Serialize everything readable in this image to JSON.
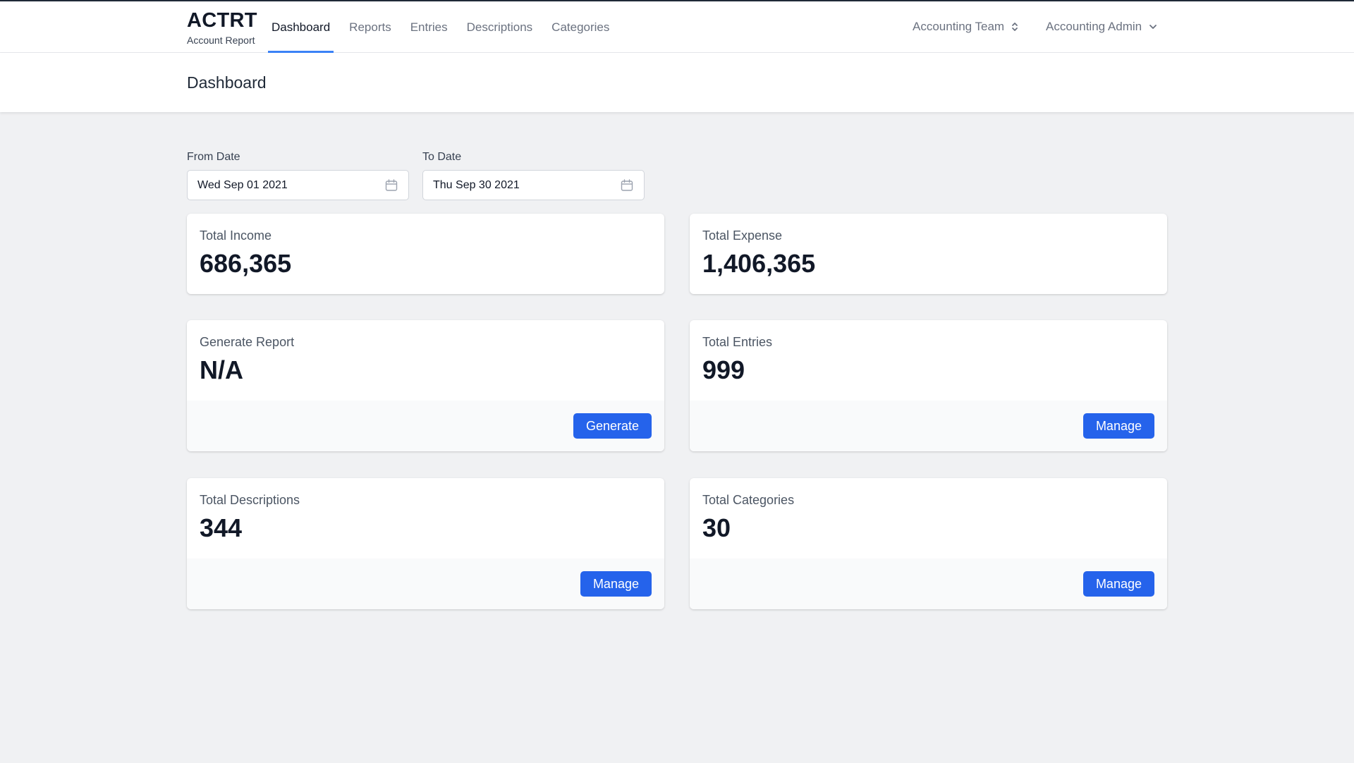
{
  "app": {
    "brand_title": "ACTRT",
    "brand_subtitle": "Account Report"
  },
  "nav": {
    "tabs": [
      {
        "label": "Dashboard",
        "active": true
      },
      {
        "label": "Reports",
        "active": false
      },
      {
        "label": "Entries",
        "active": false
      },
      {
        "label": "Descriptions",
        "active": false
      },
      {
        "label": "Categories",
        "active": false
      }
    ],
    "team": "Accounting Team",
    "user": "Accounting Admin"
  },
  "header": {
    "title": "Dashboard"
  },
  "filters": {
    "from_label": "From Date",
    "from_value": "Wed Sep 01 2021",
    "to_label": "To Date",
    "to_value": "Thu Sep 30 2021"
  },
  "cards": {
    "income": {
      "label": "Total Income",
      "value": "686,365"
    },
    "expense": {
      "label": "Total Expense",
      "value": "1,406,365"
    },
    "report": {
      "label": "Generate Report",
      "value": "N/A",
      "button": "Generate"
    },
    "entries": {
      "label": "Total Entries",
      "value": "999",
      "button": "Manage"
    },
    "descriptions": {
      "label": "Total Descriptions",
      "value": "344",
      "button": "Manage"
    },
    "categories": {
      "label": "Total Categories",
      "value": "30",
      "button": "Manage"
    }
  },
  "colors": {
    "accent": "#2563eb",
    "active_tab_underline": "#3b82f6",
    "page_background": "#f0f1f3"
  },
  "icons": {
    "calendar": "calendar-icon",
    "team_selector": "chevron-up-down-icon",
    "user_menu": "chevron-down-icon"
  }
}
